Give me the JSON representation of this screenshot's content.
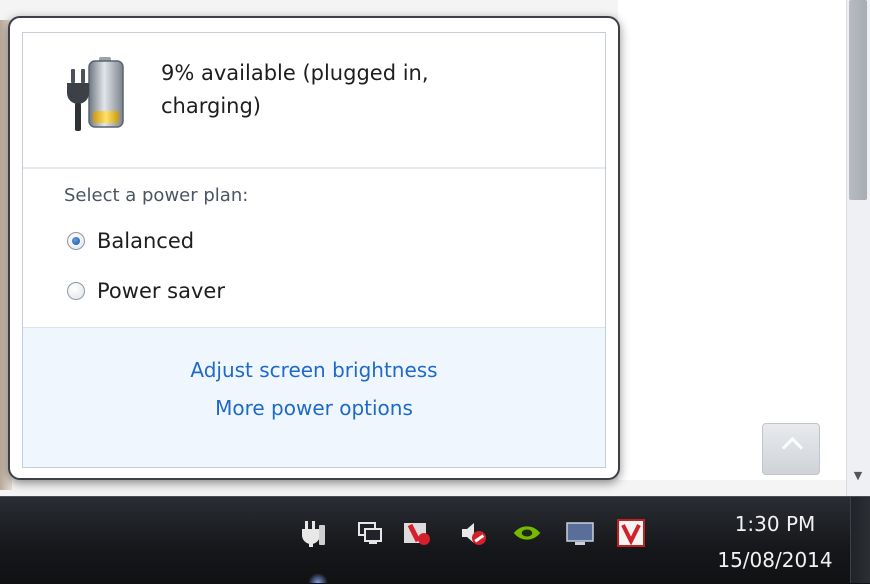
{
  "battery": {
    "status_line1": "9% available (plugged in,",
    "status_line2": "charging)",
    "percent": 9,
    "icon": "battery-charging-icon"
  },
  "power_plan": {
    "heading": "Select a power plan:",
    "options": [
      {
        "label": "Balanced",
        "selected": true
      },
      {
        "label": "Power saver",
        "selected": false
      }
    ]
  },
  "links": {
    "brightness": "Adjust screen brightness",
    "more_options": "More power options"
  },
  "taskbar": {
    "tray_icons": [
      "power-icon",
      "network-icon",
      "antivirus-icon",
      "volume-muted-icon",
      "nvidia-icon",
      "display-icon",
      "v-app-icon"
    ],
    "time": "1:30 PM",
    "date": "15/08/2014"
  },
  "colors": {
    "link": "#1f6ac8",
    "taskbar": "#15171a",
    "battery_fill": "#f2c21b"
  }
}
